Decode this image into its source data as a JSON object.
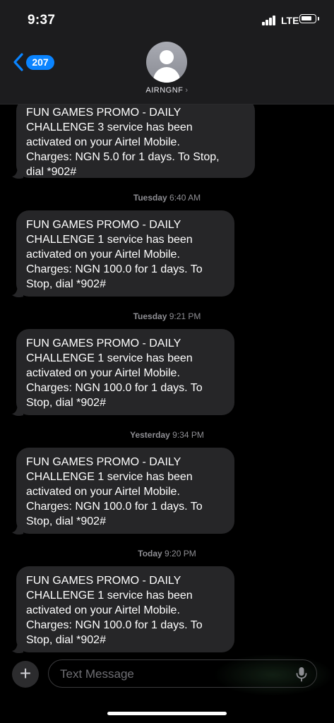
{
  "status_bar": {
    "time": "9:37",
    "network": "LTE"
  },
  "header": {
    "back_count": "207",
    "contact_name": "AIRNGNF",
    "contact_chevron": "›"
  },
  "messages": [
    {
      "lines": [
        "FUN GAMES PROMO - DAILY",
        "CHALLENGE 3 service has been",
        "activated on your Airtel Mobile.",
        "Charges: NGN 5.0 for 1 days. To Stop,",
        "dial *902#"
      ]
    },
    {
      "stamp_day": "Tuesday",
      "stamp_time": "6:40 AM",
      "lines": [
        "FUN GAMES PROMO - DAILY",
        "CHALLENGE 1 service has been",
        "activated on your Airtel Mobile.",
        "Charges: NGN 100.0 for 1 days. To",
        "Stop, dial *902#"
      ]
    },
    {
      "stamp_day": "Tuesday",
      "stamp_time": "9:21 PM",
      "lines": [
        "FUN GAMES PROMO - DAILY",
        "CHALLENGE 1 service has been",
        "activated on your Airtel Mobile.",
        "Charges: NGN 100.0 for 1 days. To",
        "Stop, dial *902#"
      ]
    },
    {
      "stamp_day": "Yesterday",
      "stamp_time": "9:34 PM",
      "lines": [
        "FUN GAMES PROMO - DAILY",
        "CHALLENGE 1 service has been",
        "activated on your Airtel Mobile.",
        "Charges: NGN 100.0 for 1 days. To",
        "Stop, dial *902#"
      ]
    },
    {
      "stamp_day": "Today",
      "stamp_time": "9:20 PM",
      "lines": [
        "FUN GAMES PROMO - DAILY",
        "CHALLENGE 1 service has been",
        "activated on your Airtel Mobile.",
        "Charges: NGN 100.0 for 1 days. To",
        "Stop, dial *902#"
      ]
    }
  ],
  "composer": {
    "plus_label": "+",
    "placeholder": "Text Message"
  },
  "icons": {
    "back": "chevron-left-icon",
    "mic": "microphone-icon",
    "avatar": "person-icon"
  },
  "colors": {
    "accent": "#0a84ff",
    "bubble": "#262628",
    "header_bg": "#1c1c1e",
    "timestamp": "#8e8e93"
  }
}
